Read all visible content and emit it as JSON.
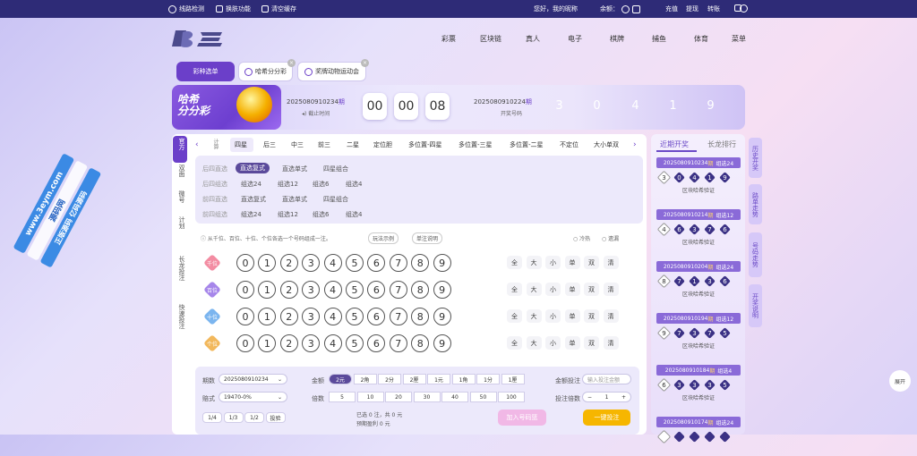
{
  "topbar": {
    "links": [
      "线路检测",
      "换肤功能",
      "清空缓存"
    ],
    "greeting": "您好，我的昵称",
    "balance_label": "余额：",
    "actions": [
      "充值",
      "提现",
      "转账"
    ]
  },
  "logo": {
    "text": "亿"
  },
  "nav": [
    "彩票",
    "区块链",
    "真人",
    "电子",
    "棋牌",
    "捕鱼",
    "体育",
    "菜单"
  ],
  "lottery_tabs": {
    "active": "彩种选单",
    "tabs": [
      "哈希分分彩",
      "奖牌动物运动会"
    ]
  },
  "banner": {
    "title_line1": "哈希",
    "title_line2": "分分彩",
    "current_issue": "2025080910234",
    "current_issue_suffix": "期",
    "deadline_label": "截止时间",
    "countdown": [
      "00",
      "00",
      "08"
    ],
    "prev_issue": "2025080910224",
    "prev_issue_suffix": "期",
    "result_label": "开奖号码",
    "result_numbers": [
      "3",
      "0",
      "4",
      "1",
      "9"
    ]
  },
  "side_tabs": [
    "官方",
    "双面",
    "微号",
    "计划",
    "长龙投注",
    "快速投注"
  ],
  "play_tabs": [
    "计算",
    "四星",
    "后三",
    "中三",
    "前三",
    "二星",
    "定位胆",
    "多位置-四星",
    "多位置-三星",
    "多位置-二星",
    "不定位",
    "大小单双"
  ],
  "play_options": [
    {
      "label": "后四直选",
      "items": [
        "直选复式",
        "直选单式",
        "四星组合"
      ]
    },
    {
      "label": "后四组选",
      "items": [
        "组选24",
        "组选12",
        "组选6",
        "组选4"
      ]
    },
    {
      "label": "前四直选",
      "items": [
        "直选复式",
        "直选单式",
        "四星组合"
      ]
    },
    {
      "label": "前四组选",
      "items": [
        "组选24",
        "组选12",
        "组选6",
        "组选4"
      ]
    }
  ],
  "hint": "从千位、百位、十位、个位各选一个号码组成一注。",
  "hint_buttons": [
    "玩法示例",
    "单注说明"
  ],
  "hot_cold": [
    "冷热",
    "遗漏"
  ],
  "positions": [
    "千位",
    "百位",
    "十位",
    "个位"
  ],
  "digits": [
    "0",
    "1",
    "2",
    "3",
    "4",
    "5",
    "6",
    "7",
    "8",
    "9"
  ],
  "quick_picks": [
    "全",
    "大",
    "小",
    "单",
    "双",
    "清"
  ],
  "bottom": {
    "issue_label": "期数",
    "issue_value": "2025080910234",
    "mode_label": "赔式",
    "mode_value": "19470-0%",
    "amount_label": "金额",
    "amounts": [
      "2元",
      "2角",
      "2分",
      "2厘",
      "1元",
      "1角",
      "1分",
      "1厘"
    ],
    "multiple_label": "倍数",
    "multiples": [
      "5",
      "10",
      "20",
      "30",
      "40",
      "50",
      "100"
    ],
    "fractions": [
      "1/4",
      "1/3",
      "1/2",
      "投验"
    ],
    "bet_amount_label": "金额投注",
    "bet_amount_placeholder": "输入投注金额",
    "bet_count_label": "投注倍数",
    "bet_count_value": "1",
    "selected_text": "已选 0 注，共 0 元",
    "profit_text": "预期盈利 0 元",
    "add_button": "加入号码篮",
    "bet_button": "一键投注"
  },
  "right_panel": {
    "tabs": [
      "近期开奖",
      "长龙排行"
    ],
    "records": [
      {
        "issue": "2025080910234",
        "suffix": "期",
        "type": "组选24",
        "numbers": [
          "3",
          "0",
          "4",
          "1",
          "9"
        ],
        "verify": "区块哈希验证"
      },
      {
        "issue": "2025080910214",
        "suffix": "期",
        "type": "组选12",
        "numbers": [
          "4",
          "6",
          "3",
          "7",
          "6"
        ],
        "verify": "区块哈希验证"
      },
      {
        "issue": "2025080910204",
        "suffix": "期",
        "type": "组选24",
        "numbers": [
          "8",
          "7",
          "1",
          "3",
          "6"
        ],
        "verify": "区块哈希验证"
      },
      {
        "issue": "2025080910194",
        "suffix": "期",
        "type": "组选12",
        "numbers": [
          "9",
          "7",
          "3",
          "7",
          "5"
        ],
        "verify": "区块哈希验证"
      },
      {
        "issue": "2025080910184",
        "suffix": "期",
        "type": "组选4",
        "numbers": [
          "6",
          "3",
          "3",
          "3",
          "5"
        ],
        "verify": "区块哈希验证"
      },
      {
        "issue": "2025080910174",
        "suffix": "期",
        "type": "组选24",
        "numbers": [
          "",
          "",
          "",
          "",
          ""
        ],
        "verify": ""
      }
    ]
  },
  "vertical_tabs": [
    "历史开奖",
    "路单走势",
    "号码走势",
    "开奖说明"
  ],
  "expand_button": "展开",
  "watermark": {
    "line1": "www.3eym.com",
    "line2": "源码网",
    "line3": "正版源码 亿码源码"
  },
  "colors": {
    "topbar": "#2e2b77",
    "accent": "#6b3fc9",
    "bet": "#f6b600"
  }
}
